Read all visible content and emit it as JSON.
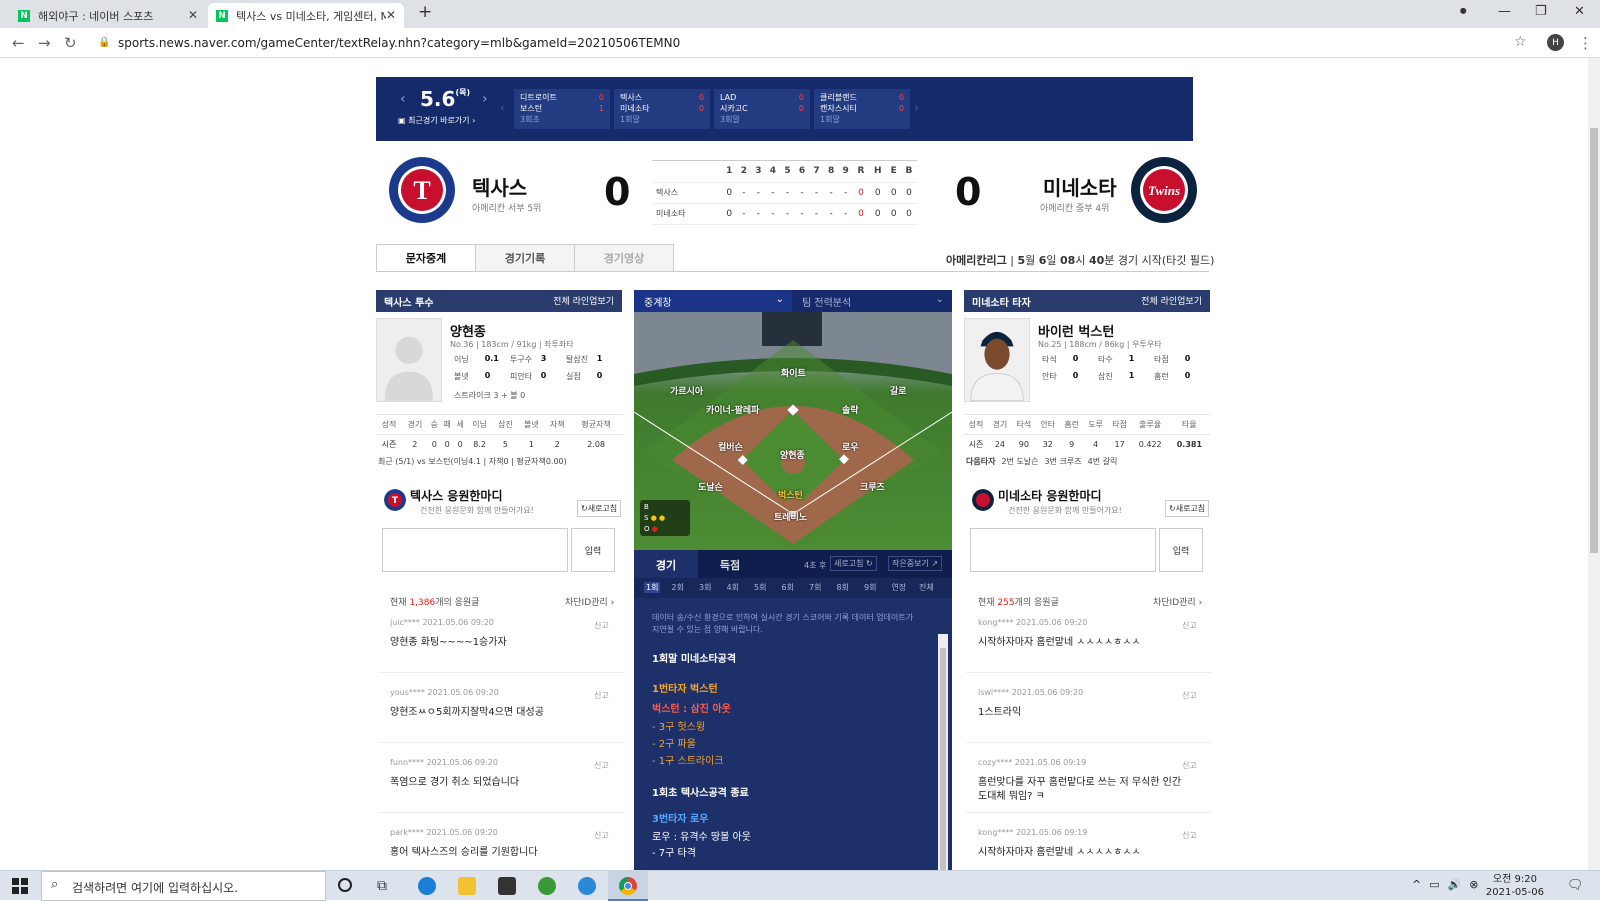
{
  "browser": {
    "tabs": [
      {
        "title": "해외야구 : 네이버 스포츠"
      },
      {
        "title": "텍사스 vs 미네소타, 게임센터, M"
      }
    ],
    "url": "sports.news.naver.com/gameCenter/textRelay.nhn?category=mlb&gameId=20210506TEMN0",
    "profile": "H"
  },
  "strip": {
    "date": "5.6",
    "weekday": "(목)",
    "recent_link": "최근경기 바로가기",
    "games": [
      {
        "away": "디트로이트",
        "home": "보스턴",
        "away_score": "0",
        "home_score": "1",
        "status": "3회초"
      },
      {
        "away": "텍사스",
        "home": "미네소타",
        "away_score": "0",
        "home_score": "0",
        "status": "1회말"
      },
      {
        "away": "LAD",
        "home": "시카고C",
        "away_score": "0",
        "home_score": "0",
        "status": "3회말"
      },
      {
        "away": "클리블랜드",
        "home": "캔자스시티",
        "away_score": "0",
        "home_score": "0",
        "status": "1회말"
      }
    ]
  },
  "header": {
    "away": {
      "name": "텍사스",
      "rank": "아메리칸 서부 5위",
      "score": "0",
      "logo_text": "T",
      "logo_ring": "TEXAS RANGERS"
    },
    "home": {
      "name": "미네소타",
      "rank": "아메리칸 중부 4위",
      "score": "0",
      "logo_text": "Twins",
      "logo_ring": "MINNESOTA BASEBALL CLUB"
    }
  },
  "linescore": {
    "cols": [
      "1",
      "2",
      "3",
      "4",
      "5",
      "6",
      "7",
      "8",
      "9",
      "R",
      "H",
      "E",
      "B"
    ],
    "rows": [
      {
        "team": "텍사스",
        "vals": [
          "0",
          "-",
          "-",
          "-",
          "-",
          "-",
          "-",
          "-",
          "-",
          "0",
          "0",
          "0",
          "0"
        ]
      },
      {
        "team": "미네소타",
        "vals": [
          "0",
          "-",
          "-",
          "-",
          "-",
          "-",
          "-",
          "-",
          "-",
          "0",
          "0",
          "0",
          "0"
        ]
      }
    ]
  },
  "tabs": {
    "relay": "문자중계",
    "record": "경기기록",
    "video": "경기영상"
  },
  "gameinfo": {
    "league": "아메리칸리그",
    "month": "5",
    "day": "6",
    "hour": "08",
    "minute": "40",
    "rest": "경기 시작(타깃 필드)",
    "m_unit": "월",
    "d_unit": "일",
    "h_unit": "시",
    "min_unit": "분"
  },
  "pitcher": {
    "head": "텍사스 투수",
    "lineup": "전체 라인업보기",
    "name": "양현종",
    "info": "No.36 | 183cm / 91kg | 좌투좌타",
    "grid": [
      [
        "이닝",
        "0.1",
        "투구수",
        "3",
        "탈삼진",
        "1"
      ],
      [
        "볼넷",
        "0",
        "피안타",
        "0",
        "실점",
        "0"
      ]
    ],
    "strike": "스트라이크 3 + 볼 0",
    "stat_head": [
      "성적",
      "경기",
      "승",
      "패",
      "세",
      "이닝",
      "삼진",
      "볼넷",
      "자책",
      "평균자책"
    ],
    "stat_row": [
      "시즌",
      "2",
      "0",
      "0",
      "0",
      "8.2",
      "5",
      "1",
      "2",
      "2.08"
    ],
    "recent": "최근 (5/1) vs 보스턴(이닝4.1 | 자책0 | 평균자책0.00)"
  },
  "batter": {
    "head": "미네소타 타자",
    "lineup": "전체 라인업보기",
    "name": "바이런 벅스턴",
    "info": "No.25 | 188cm / 86kg | 우투우타",
    "grid": [
      [
        "타석",
        "0",
        "타수",
        "1",
        "타점",
        "0"
      ],
      [
        "안타",
        "0",
        "삼진",
        "1",
        "홈런",
        "0"
      ]
    ],
    "stat_head": [
      "성적",
      "경기",
      "타석",
      "안타",
      "홈런",
      "도루",
      "타점",
      "출루율",
      "타율"
    ],
    "stat_row": [
      "시즌",
      "24",
      "90",
      "32",
      "9",
      "4",
      "17",
      "0.422",
      "0.381"
    ],
    "next": [
      "다음타자",
      "2번 도날슨",
      "3번 크루즈",
      "4번 갈릭"
    ]
  },
  "cheer_left": {
    "title": "텍사스 응원한마디",
    "sub": "건전한 응원문화 함께 만들어가요!",
    "refresh": "새로고침",
    "submit": "입력",
    "count_pre": "현재 ",
    "count": "1,386",
    "count_post": "개의 응원글",
    "block": "차단ID관리",
    "comments": [
      {
        "user": "juic****",
        "time": "2021.05.06 09:20",
        "text": "양현종 화팅~~~~1승가자"
      },
      {
        "user": "yous****",
        "time": "2021.05.06 09:20",
        "text": "양현조ㅆㅇ5회까지잘막4으면 대성공"
      },
      {
        "user": "funn****",
        "time": "2021.05.06 09:20",
        "text": "폭염으로 경기 취소 되었습니다"
      },
      {
        "user": "park****",
        "time": "2021.05.06 09:20",
        "text": "홍어 텍사스즈의 승리를 기원합니다"
      }
    ],
    "report": "신고"
  },
  "cheer_right": {
    "title": "미네소타 응원한마디",
    "sub": "건전한 응원문화 함께 만들어가요!",
    "refresh": "새로고침",
    "submit": "입력",
    "count_pre": "현재 ",
    "count": "255",
    "count_post": "개의 응원글",
    "block": "차단ID관리",
    "comments": [
      {
        "user": "kong****",
        "time": "2021.05.06 09:20",
        "text": "시작하자마자 홈런맡네 ㅅㅅㅅㅅㅎㅅㅅ"
      },
      {
        "user": "lswl****",
        "time": "2021.05.06 09:20",
        "text": "1스트라익"
      },
      {
        "user": "cozy****",
        "time": "2021.05.06 09:19",
        "text": "홈런맞다를 자꾸 홈런맡다로 쓰는 저 무식한 인간 도대체 뭐임? ㅋ"
      },
      {
        "user": "kong****",
        "time": "2021.05.06 09:19",
        "text": "시작하자마자 홈런맡네 ㅅㅅㅅㅅㅎㅅㅅ"
      }
    ],
    "report": "신고"
  },
  "relay": {
    "select1": "중계창",
    "select2": "팀 전력분석",
    "positions": {
      "cf": "화이트",
      "lf": "가르시아",
      "rf": "갈로",
      "ss": "카이너-팔레파",
      "b2": "솔락",
      "b3": "컬버슨",
      "p": "양현종",
      "b1": "로우",
      "lfield": "도날슨",
      "rfield": "크루즈",
      "batter": "벅스턴",
      "catcher": "트레비노"
    },
    "bso": [
      "B",
      "S",
      "O"
    ],
    "tab_game": "경기",
    "tab_score": "득점",
    "inning_label": "4초 후",
    "refresh": "새로고침",
    "small": "작은중보기",
    "innings": [
      "1회",
      "2회",
      "3회",
      "4회",
      "5회",
      "6회",
      "7회",
      "8회",
      "9회",
      "연장",
      "전체"
    ],
    "notice": "데이터 송/수신 환경으로 인하여 실시간 경기 스코어와 기록 데이터 업데이트가 지연될 수 있는 점 양해 바랍니다.",
    "lines": [
      {
        "t": "1회말 미네소타공격",
        "c": "#ffffff",
        "b": true
      },
      {
        "t": "1번타자 벅스턴",
        "c": "#f5a623",
        "b": true
      },
      {
        "t": "벅스턴 : 삼진 아웃",
        "c": "#ff5a4a",
        "b": true
      },
      {
        "t": "- 3구 헛스윙",
        "c": "#f5a623",
        "b": false
      },
      {
        "t": "- 2구 파울",
        "c": "#f5a623",
        "b": false
      },
      {
        "t": "- 1구 스트라이크",
        "c": "#f5a623",
        "b": false
      },
      {
        "t": "1회초 텍사스공격 종료",
        "c": "#ffffff",
        "b": true
      },
      {
        "t": "3번타자 로우",
        "c": "#5aa9ff",
        "b": true
      },
      {
        "t": "로우 : 유격수 땅볼 아웃",
        "c": "#ffffff",
        "b": false
      },
      {
        "t": "- 7구 타격",
        "c": "#ffffff",
        "b": false
      }
    ]
  },
  "taskbar": {
    "search": "검색하려면 여기에 입력하십시오.",
    "time": "오전 9:20",
    "date": "2021-05-06"
  },
  "colors": {
    "navy": "#152a6b",
    "red": "#e0201b",
    "orange": "#f5a623"
  }
}
